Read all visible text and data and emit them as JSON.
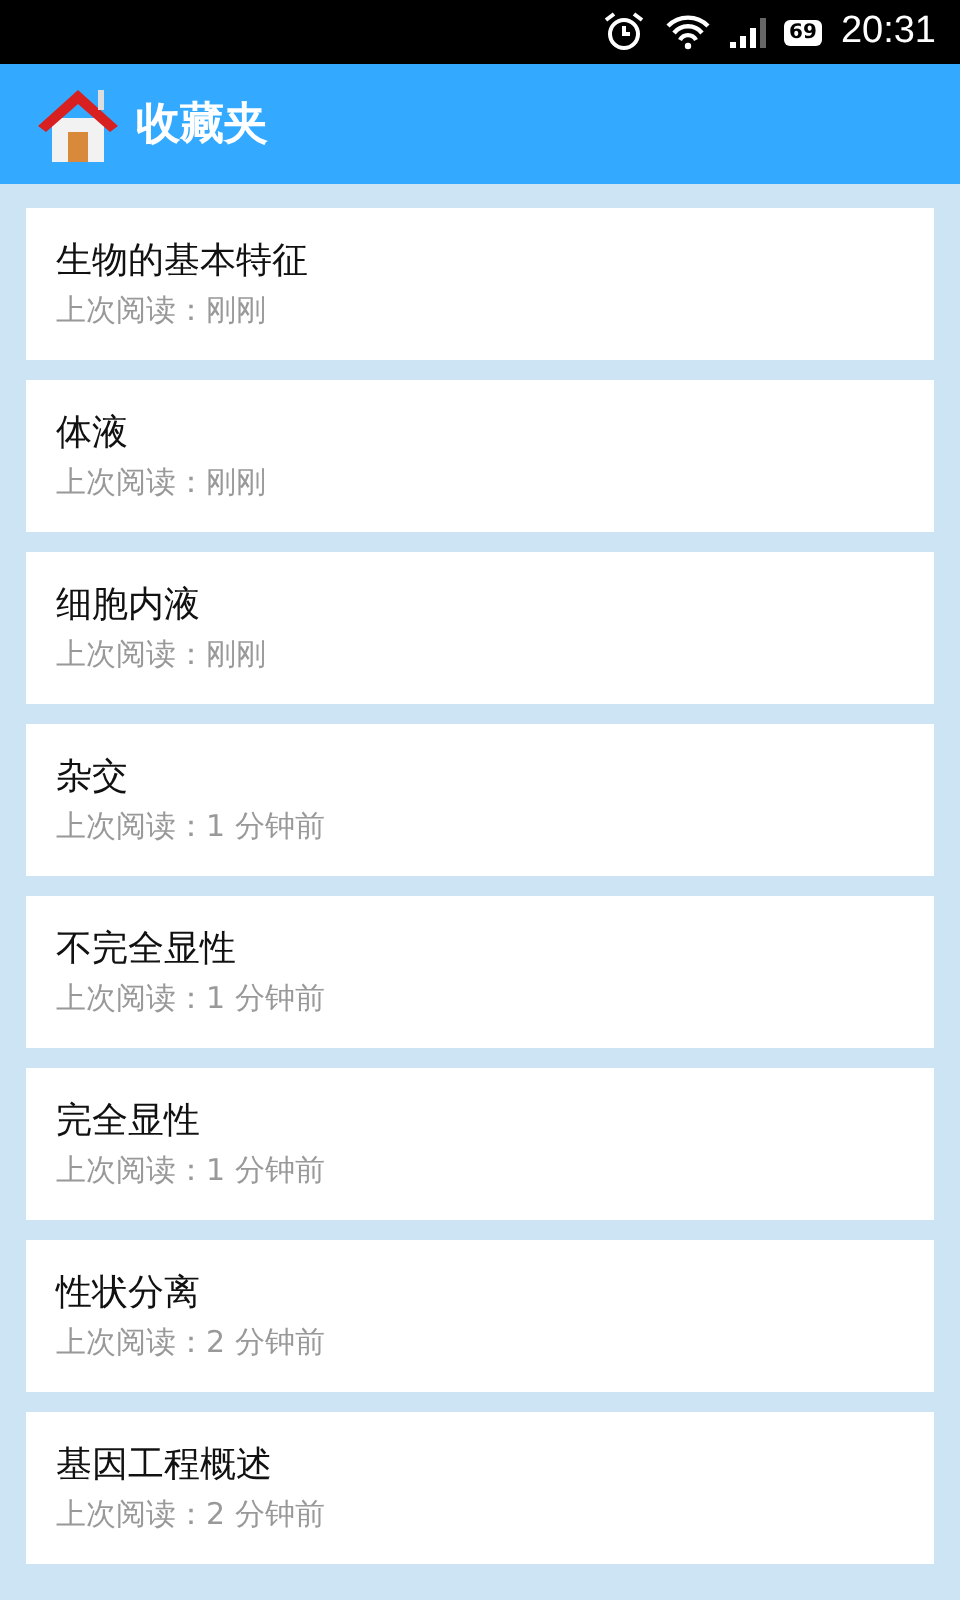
{
  "status_bar": {
    "battery": "69",
    "time": "20:31"
  },
  "header": {
    "title": "收藏夹"
  },
  "items": [
    {
      "title": "生物的基本特征",
      "subtitle": "上次阅读：刚刚"
    },
    {
      "title": "体液",
      "subtitle": "上次阅读：刚刚"
    },
    {
      "title": "细胞内液",
      "subtitle": "上次阅读：刚刚"
    },
    {
      "title": "杂交",
      "subtitle": "上次阅读：1 分钟前"
    },
    {
      "title": "不完全显性",
      "subtitle": "上次阅读：1 分钟前"
    },
    {
      "title": "完全显性",
      "subtitle": "上次阅读：1 分钟前"
    },
    {
      "title": "性状分离",
      "subtitle": "上次阅读：2 分钟前"
    },
    {
      "title": "基因工程概述",
      "subtitle": "上次阅读：2 分钟前"
    }
  ]
}
